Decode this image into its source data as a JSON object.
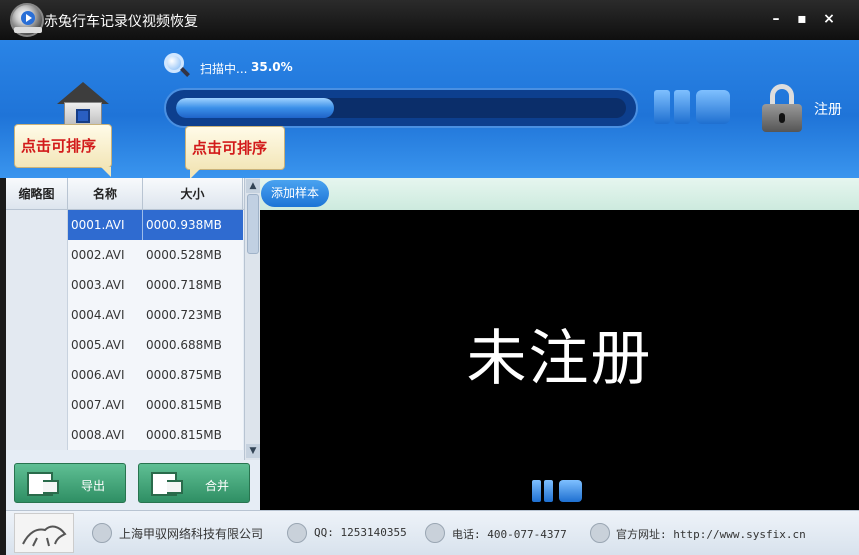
{
  "app": {
    "title": "赤兔行车记录仪视频恢复",
    "window_controls": [
      "minimize",
      "maximize",
      "close"
    ]
  },
  "scan": {
    "status_text": "扫描中...",
    "percent_text": "35.0%",
    "progress": 0.35
  },
  "register": {
    "label": "注册"
  },
  "tooltips": {
    "sort_by_name": "点击可排序",
    "sort_by_size": "点击可排序"
  },
  "list": {
    "columns": [
      "缩略图",
      "名称",
      "大小"
    ],
    "rows": [
      {
        "name": "0001.AVI",
        "size": "0000.938MB",
        "selected": true
      },
      {
        "name": "0002.AVI",
        "size": "0000.528MB"
      },
      {
        "name": "0003.AVI",
        "size": "0000.718MB"
      },
      {
        "name": "0004.AVI",
        "size": "0000.723MB"
      },
      {
        "name": "0005.AVI",
        "size": "0000.688MB"
      },
      {
        "name": "0006.AVI",
        "size": "0000.875MB"
      },
      {
        "name": "0007.AVI",
        "size": "0000.815MB"
      },
      {
        "name": "0008.AVI",
        "size": "0000.815MB"
      }
    ]
  },
  "actions": {
    "export_label": "导出",
    "merge_label": "合并"
  },
  "preview": {
    "add_sample_label": "添加样本",
    "watermark": "未注册"
  },
  "footer": {
    "company": "上海甲驭网络科技有限公司",
    "qq": "QQ: 1253140355",
    "phone": "电话: 400-077-4377",
    "website": "官方网址: http://www.sysfix.cn"
  },
  "colors": {
    "header_blue": "#2a84e6",
    "selected_row": "#2f6bd0",
    "action_green": "#3e9f72",
    "tooltip_text": "#d21a1a"
  }
}
